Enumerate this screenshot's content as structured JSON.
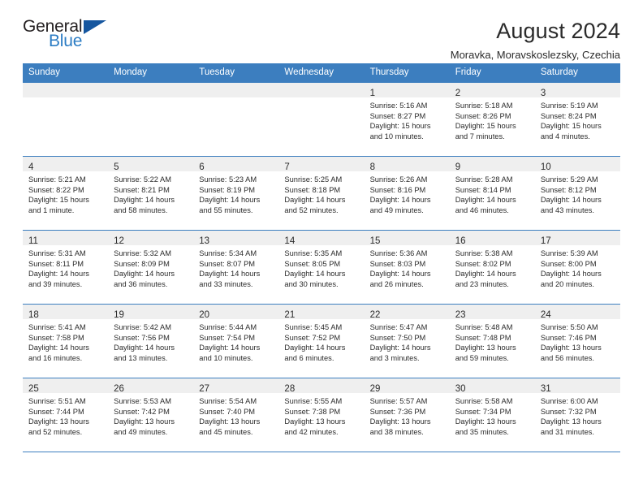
{
  "brand": {
    "name_top": "General",
    "name_bottom": "Blue",
    "flag_icon": "blue-triangle-flag-icon",
    "accent_color": "#2b7cc4",
    "flag_color": "#15569f"
  },
  "header": {
    "title": "August 2024",
    "subtitle": "Moravka, Moravskoslezsky, Czechia"
  },
  "calendar": {
    "header_bg": "#3c7ebf",
    "daynum_bg": "#efefef",
    "weekdays": [
      "Sunday",
      "Monday",
      "Tuesday",
      "Wednesday",
      "Thursday",
      "Friday",
      "Saturday"
    ],
    "labels": {
      "sunrise": "Sunrise:",
      "sunset": "Sunset:",
      "daylight": "Daylight:"
    },
    "weeks": [
      [
        {
          "day": ""
        },
        {
          "day": ""
        },
        {
          "day": ""
        },
        {
          "day": ""
        },
        {
          "day": "1",
          "sunrise": "Sunrise: 5:16 AM",
          "sunset": "Sunset: 8:27 PM",
          "daylight1": "Daylight: 15 hours",
          "daylight2": "and 10 minutes."
        },
        {
          "day": "2",
          "sunrise": "Sunrise: 5:18 AM",
          "sunset": "Sunset: 8:26 PM",
          "daylight1": "Daylight: 15 hours",
          "daylight2": "and 7 minutes."
        },
        {
          "day": "3",
          "sunrise": "Sunrise: 5:19 AM",
          "sunset": "Sunset: 8:24 PM",
          "daylight1": "Daylight: 15 hours",
          "daylight2": "and 4 minutes."
        }
      ],
      [
        {
          "day": "4",
          "sunrise": "Sunrise: 5:21 AM",
          "sunset": "Sunset: 8:22 PM",
          "daylight1": "Daylight: 15 hours",
          "daylight2": "and 1 minute."
        },
        {
          "day": "5",
          "sunrise": "Sunrise: 5:22 AM",
          "sunset": "Sunset: 8:21 PM",
          "daylight1": "Daylight: 14 hours",
          "daylight2": "and 58 minutes."
        },
        {
          "day": "6",
          "sunrise": "Sunrise: 5:23 AM",
          "sunset": "Sunset: 8:19 PM",
          "daylight1": "Daylight: 14 hours",
          "daylight2": "and 55 minutes."
        },
        {
          "day": "7",
          "sunrise": "Sunrise: 5:25 AM",
          "sunset": "Sunset: 8:18 PM",
          "daylight1": "Daylight: 14 hours",
          "daylight2": "and 52 minutes."
        },
        {
          "day": "8",
          "sunrise": "Sunrise: 5:26 AM",
          "sunset": "Sunset: 8:16 PM",
          "daylight1": "Daylight: 14 hours",
          "daylight2": "and 49 minutes."
        },
        {
          "day": "9",
          "sunrise": "Sunrise: 5:28 AM",
          "sunset": "Sunset: 8:14 PM",
          "daylight1": "Daylight: 14 hours",
          "daylight2": "and 46 minutes."
        },
        {
          "day": "10",
          "sunrise": "Sunrise: 5:29 AM",
          "sunset": "Sunset: 8:12 PM",
          "daylight1": "Daylight: 14 hours",
          "daylight2": "and 43 minutes."
        }
      ],
      [
        {
          "day": "11",
          "sunrise": "Sunrise: 5:31 AM",
          "sunset": "Sunset: 8:11 PM",
          "daylight1": "Daylight: 14 hours",
          "daylight2": "and 39 minutes."
        },
        {
          "day": "12",
          "sunrise": "Sunrise: 5:32 AM",
          "sunset": "Sunset: 8:09 PM",
          "daylight1": "Daylight: 14 hours",
          "daylight2": "and 36 minutes."
        },
        {
          "day": "13",
          "sunrise": "Sunrise: 5:34 AM",
          "sunset": "Sunset: 8:07 PM",
          "daylight1": "Daylight: 14 hours",
          "daylight2": "and 33 minutes."
        },
        {
          "day": "14",
          "sunrise": "Sunrise: 5:35 AM",
          "sunset": "Sunset: 8:05 PM",
          "daylight1": "Daylight: 14 hours",
          "daylight2": "and 30 minutes."
        },
        {
          "day": "15",
          "sunrise": "Sunrise: 5:36 AM",
          "sunset": "Sunset: 8:03 PM",
          "daylight1": "Daylight: 14 hours",
          "daylight2": "and 26 minutes."
        },
        {
          "day": "16",
          "sunrise": "Sunrise: 5:38 AM",
          "sunset": "Sunset: 8:02 PM",
          "daylight1": "Daylight: 14 hours",
          "daylight2": "and 23 minutes."
        },
        {
          "day": "17",
          "sunrise": "Sunrise: 5:39 AM",
          "sunset": "Sunset: 8:00 PM",
          "daylight1": "Daylight: 14 hours",
          "daylight2": "and 20 minutes."
        }
      ],
      [
        {
          "day": "18",
          "sunrise": "Sunrise: 5:41 AM",
          "sunset": "Sunset: 7:58 PM",
          "daylight1": "Daylight: 14 hours",
          "daylight2": "and 16 minutes."
        },
        {
          "day": "19",
          "sunrise": "Sunrise: 5:42 AM",
          "sunset": "Sunset: 7:56 PM",
          "daylight1": "Daylight: 14 hours",
          "daylight2": "and 13 minutes."
        },
        {
          "day": "20",
          "sunrise": "Sunrise: 5:44 AM",
          "sunset": "Sunset: 7:54 PM",
          "daylight1": "Daylight: 14 hours",
          "daylight2": "and 10 minutes."
        },
        {
          "day": "21",
          "sunrise": "Sunrise: 5:45 AM",
          "sunset": "Sunset: 7:52 PM",
          "daylight1": "Daylight: 14 hours",
          "daylight2": "and 6 minutes."
        },
        {
          "day": "22",
          "sunrise": "Sunrise: 5:47 AM",
          "sunset": "Sunset: 7:50 PM",
          "daylight1": "Daylight: 14 hours",
          "daylight2": "and 3 minutes."
        },
        {
          "day": "23",
          "sunrise": "Sunrise: 5:48 AM",
          "sunset": "Sunset: 7:48 PM",
          "daylight1": "Daylight: 13 hours",
          "daylight2": "and 59 minutes."
        },
        {
          "day": "24",
          "sunrise": "Sunrise: 5:50 AM",
          "sunset": "Sunset: 7:46 PM",
          "daylight1": "Daylight: 13 hours",
          "daylight2": "and 56 minutes."
        }
      ],
      [
        {
          "day": "25",
          "sunrise": "Sunrise: 5:51 AM",
          "sunset": "Sunset: 7:44 PM",
          "daylight1": "Daylight: 13 hours",
          "daylight2": "and 52 minutes."
        },
        {
          "day": "26",
          "sunrise": "Sunrise: 5:53 AM",
          "sunset": "Sunset: 7:42 PM",
          "daylight1": "Daylight: 13 hours",
          "daylight2": "and 49 minutes."
        },
        {
          "day": "27",
          "sunrise": "Sunrise: 5:54 AM",
          "sunset": "Sunset: 7:40 PM",
          "daylight1": "Daylight: 13 hours",
          "daylight2": "and 45 minutes."
        },
        {
          "day": "28",
          "sunrise": "Sunrise: 5:55 AM",
          "sunset": "Sunset: 7:38 PM",
          "daylight1": "Daylight: 13 hours",
          "daylight2": "and 42 minutes."
        },
        {
          "day": "29",
          "sunrise": "Sunrise: 5:57 AM",
          "sunset": "Sunset: 7:36 PM",
          "daylight1": "Daylight: 13 hours",
          "daylight2": "and 38 minutes."
        },
        {
          "day": "30",
          "sunrise": "Sunrise: 5:58 AM",
          "sunset": "Sunset: 7:34 PM",
          "daylight1": "Daylight: 13 hours",
          "daylight2": "and 35 minutes."
        },
        {
          "day": "31",
          "sunrise": "Sunrise: 6:00 AM",
          "sunset": "Sunset: 7:32 PM",
          "daylight1": "Daylight: 13 hours",
          "daylight2": "and 31 minutes."
        }
      ]
    ]
  }
}
